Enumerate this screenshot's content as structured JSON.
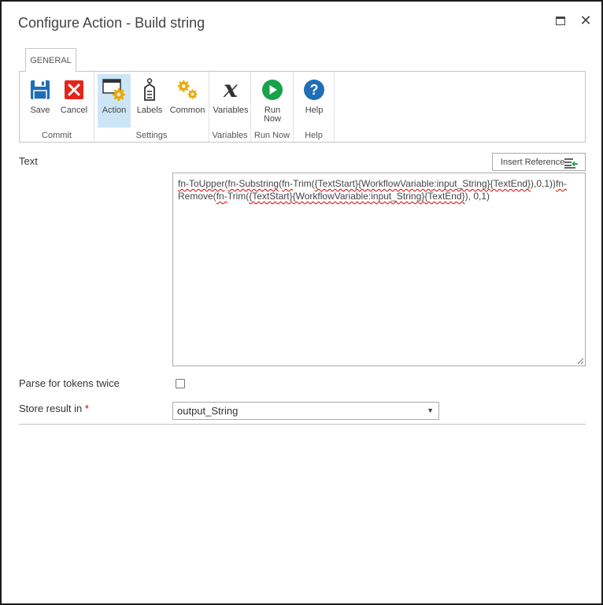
{
  "window": {
    "title": "Configure Action - Build string"
  },
  "ribbon": {
    "tab_label": "GENERAL",
    "groups": [
      {
        "label": "Commit",
        "buttons": [
          {
            "label": "Save"
          },
          {
            "label": "Cancel"
          }
        ]
      },
      {
        "label": "Settings",
        "buttons": [
          {
            "label": "Action"
          },
          {
            "label": "Labels"
          },
          {
            "label": "Common"
          }
        ]
      },
      {
        "label": "Variables",
        "buttons": [
          {
            "label": "Variables"
          }
        ]
      },
      {
        "label": "Run Now",
        "buttons": [
          {
            "label_line1": "Run",
            "label_line2": "Now"
          }
        ]
      },
      {
        "label": "Help",
        "buttons": [
          {
            "label": "Help"
          }
        ]
      }
    ]
  },
  "form": {
    "text_label": "Text",
    "insert_reference_label": "Insert Reference",
    "text_value": {
      "p1": "fn-ToUpper",
      "p2": "(",
      "p3": "fn-Substring",
      "p4": "(",
      "p5": "fn-",
      "p6": "Trim(",
      "p7": "{TextStart}",
      "p8": "{WorkflowVariable:input_String}",
      "p9": "{TextEnd}",
      "p10": "),0,1))",
      "p11": "fn-",
      "p12": "Remove(",
      "p13": "fn-",
      "p14": "Trim(",
      "p15": "{TextStart}",
      "p16": "{WorkflowVariable:input_String}",
      "p17": "{TextEnd}",
      "p18": "), 0,1)"
    },
    "parse_label": "Parse for tokens twice",
    "parse_checked": false,
    "store_label": "Store result in",
    "required_marker": "*",
    "store_value": "output_String"
  },
  "colors": {
    "save_icon": "#1e6fb5",
    "cancel_icon": "#e3261b",
    "gear": "#e8a800",
    "run_icon": "#18a34a",
    "help_icon": "#1e6fb5",
    "active_button_bg": "#cde6f7"
  }
}
